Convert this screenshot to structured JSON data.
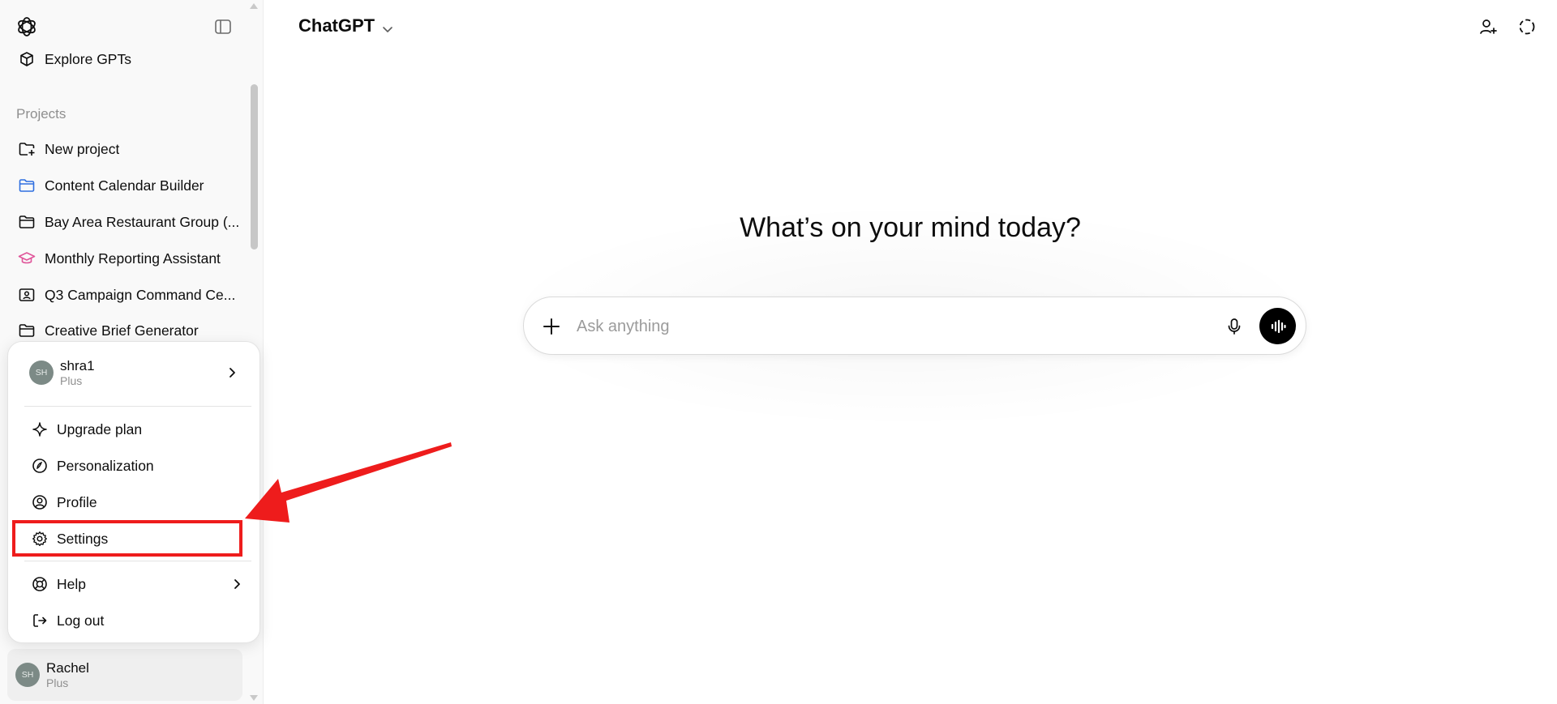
{
  "sidebar": {
    "explore": "Explore GPTs",
    "projects_label": "Projects",
    "projects": [
      {
        "label": "New project",
        "icon": "folder-plus-icon",
        "color": "#0d0d0d"
      },
      {
        "label": "Content Calendar Builder",
        "icon": "folder-icon",
        "color": "#2f6fe0"
      },
      {
        "label": "Bay Area Restaurant Group (...",
        "icon": "folder-icon",
        "color": "#0d0d0d"
      },
      {
        "label": "Monthly Reporting Assistant",
        "icon": "graduation-cap-icon",
        "color": "#e0569a"
      },
      {
        "label": "Q3 Campaign Command Ce...",
        "icon": "folder-user-icon",
        "color": "#0d0d0d"
      },
      {
        "label": "Creative Brief Generator",
        "icon": "folder-icon",
        "color": "#0d0d0d"
      }
    ]
  },
  "menu": {
    "account": {
      "name": "shra1",
      "plan": "Plus",
      "initials": "SH"
    },
    "items": [
      {
        "label": "Upgrade plan",
        "icon": "sparkle-icon"
      },
      {
        "label": "Personalization",
        "icon": "personalization-icon"
      },
      {
        "label": "Profile",
        "icon": "profile-icon"
      },
      {
        "label": "Settings",
        "icon": "gear-icon"
      },
      {
        "label": "Help",
        "icon": "lifebuoy-icon"
      },
      {
        "label": "Log out",
        "icon": "logout-icon"
      }
    ]
  },
  "bottom_user": {
    "name": "Rachel",
    "plan": "Plus",
    "initials": "SH"
  },
  "main": {
    "title": "ChatGPT",
    "headline": "What’s on your mind today?",
    "composer_placeholder": "Ask anything"
  },
  "colors": {
    "highlight": "#ee1c1c",
    "arrow": "#ee1c1c"
  }
}
